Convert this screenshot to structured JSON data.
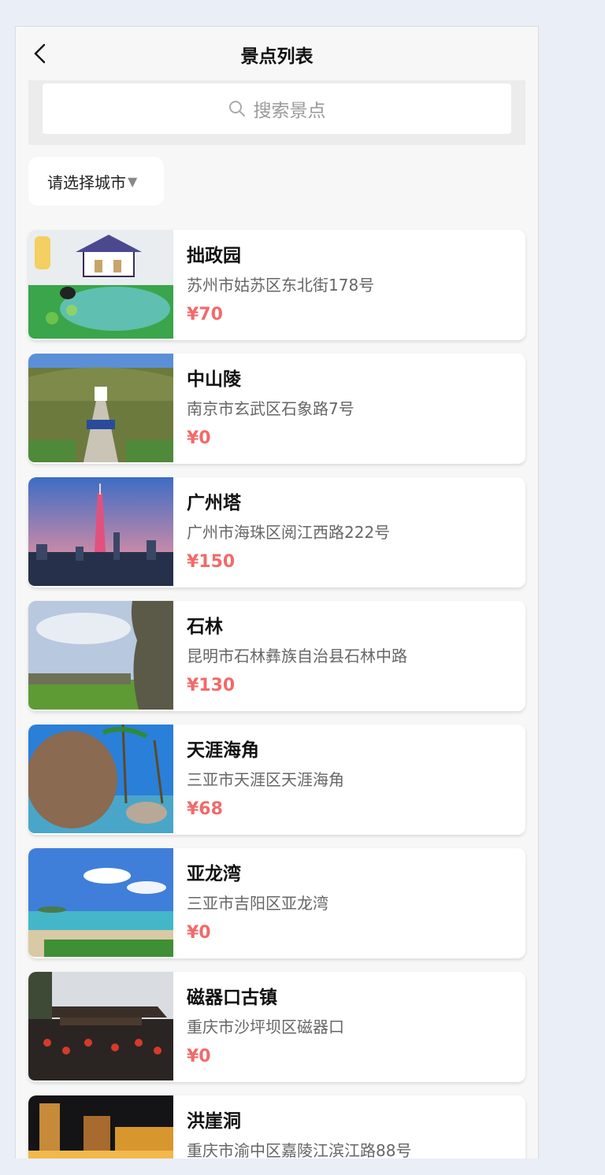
{
  "header": {
    "title": "景点列表",
    "back_icon": "chevron-left-icon"
  },
  "search": {
    "placeholder": "搜索景点",
    "icon": "search-icon"
  },
  "filter": {
    "city_label": "请选择城市",
    "arrow": "▼"
  },
  "colors": {
    "price": "#f26a6a",
    "page_bg": "#eaeef7"
  },
  "spots": [
    {
      "name": "拙政园",
      "address": "苏州市姑苏区东北街178号",
      "price": "¥70"
    },
    {
      "name": "中山陵",
      "address": "南京市玄武区石象路7号",
      "price": "¥0"
    },
    {
      "name": "广州塔",
      "address": "广州市海珠区阅江西路222号",
      "price": "¥150"
    },
    {
      "name": "石林",
      "address": "昆明市石林彝族自治县石林中路",
      "price": "¥130"
    },
    {
      "name": "天涯海角",
      "address": "三亚市天涯区天涯海角",
      "price": "¥68"
    },
    {
      "name": "亚龙湾",
      "address": "三亚市吉阳区亚龙湾",
      "price": "¥0"
    },
    {
      "name": "磁器口古镇",
      "address": "重庆市沙坪坝区磁器口",
      "price": "¥0"
    },
    {
      "name": "洪崖洞",
      "address": "重庆市渝中区嘉陵江滨江路88号",
      "price": ""
    }
  ]
}
